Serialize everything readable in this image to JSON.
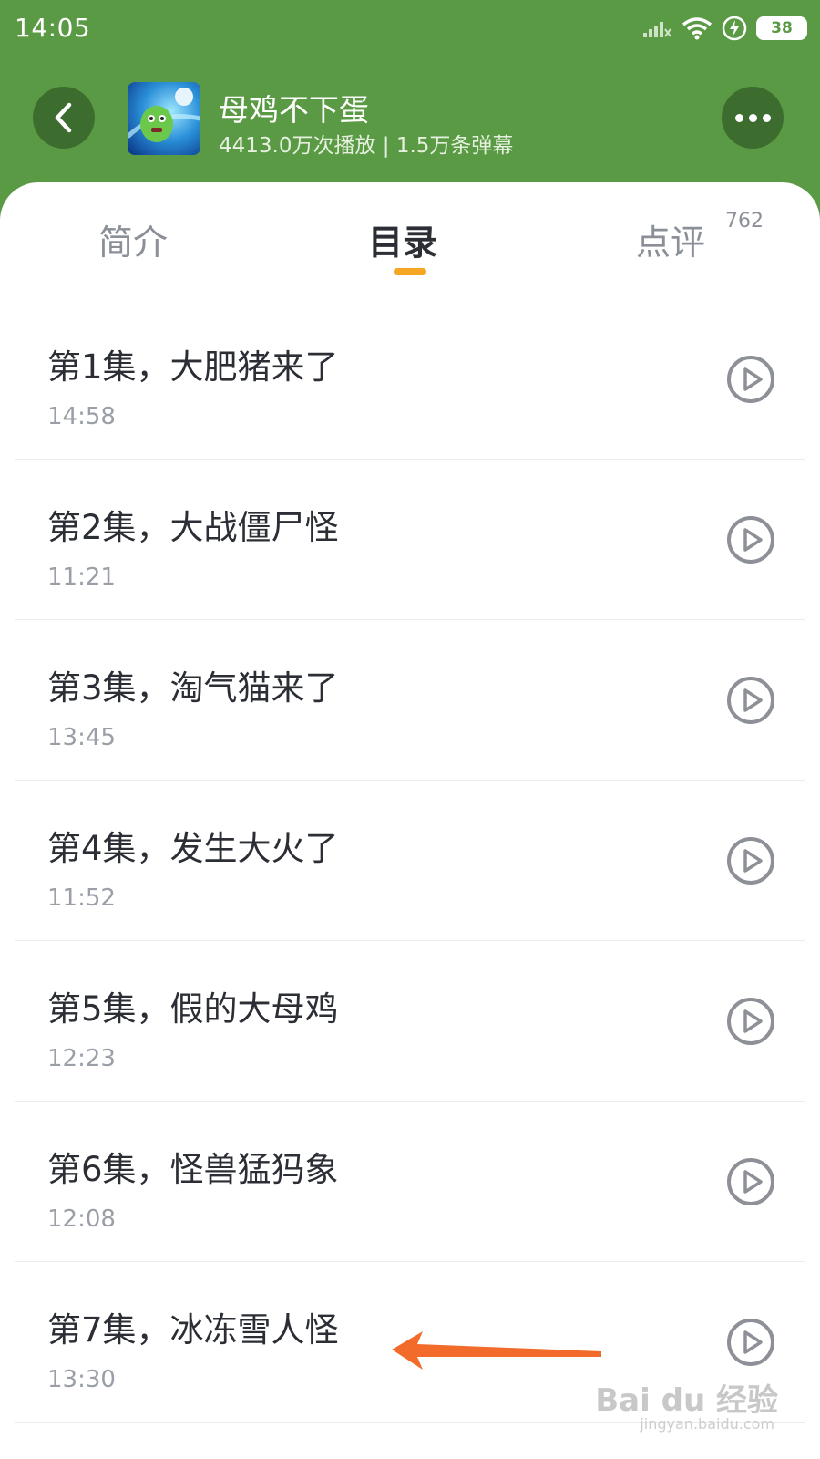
{
  "status": {
    "time": "14:05",
    "battery": "38"
  },
  "header": {
    "title": "母鸡不下蛋",
    "stats": "4413.0万次播放 | 1.5万条弹幕"
  },
  "tabs": [
    {
      "label": "简介"
    },
    {
      "label": "目录",
      "active": true
    },
    {
      "label": "点评",
      "badge": "762"
    }
  ],
  "episodes": [
    {
      "title": "第1集，大肥猪来了",
      "duration": "14:58"
    },
    {
      "title": "第2集，大战僵尸怪",
      "duration": "11:21"
    },
    {
      "title": "第3集，淘气猫来了",
      "duration": "13:45"
    },
    {
      "title": "第4集，发生大火了",
      "duration": "11:52"
    },
    {
      "title": "第5集，假的大母鸡",
      "duration": "12:23"
    },
    {
      "title": "第6集，怪兽猛犸象",
      "duration": "12:08"
    },
    {
      "title": "第7集，冰冻雪人怪",
      "duration": "13:30"
    }
  ],
  "watermark": {
    "main": "Bai du 经验",
    "sub": "jingyan.baidu.com"
  },
  "colors": {
    "header_bg": "#5a9a45",
    "accent": "#f5a623",
    "annotation": "#f26b2a"
  },
  "icons": [
    "back-arrow-icon",
    "more-dots-icon",
    "play-circle-icon",
    "signal-icon",
    "wifi-icon",
    "charging-icon",
    "battery-icon"
  ]
}
